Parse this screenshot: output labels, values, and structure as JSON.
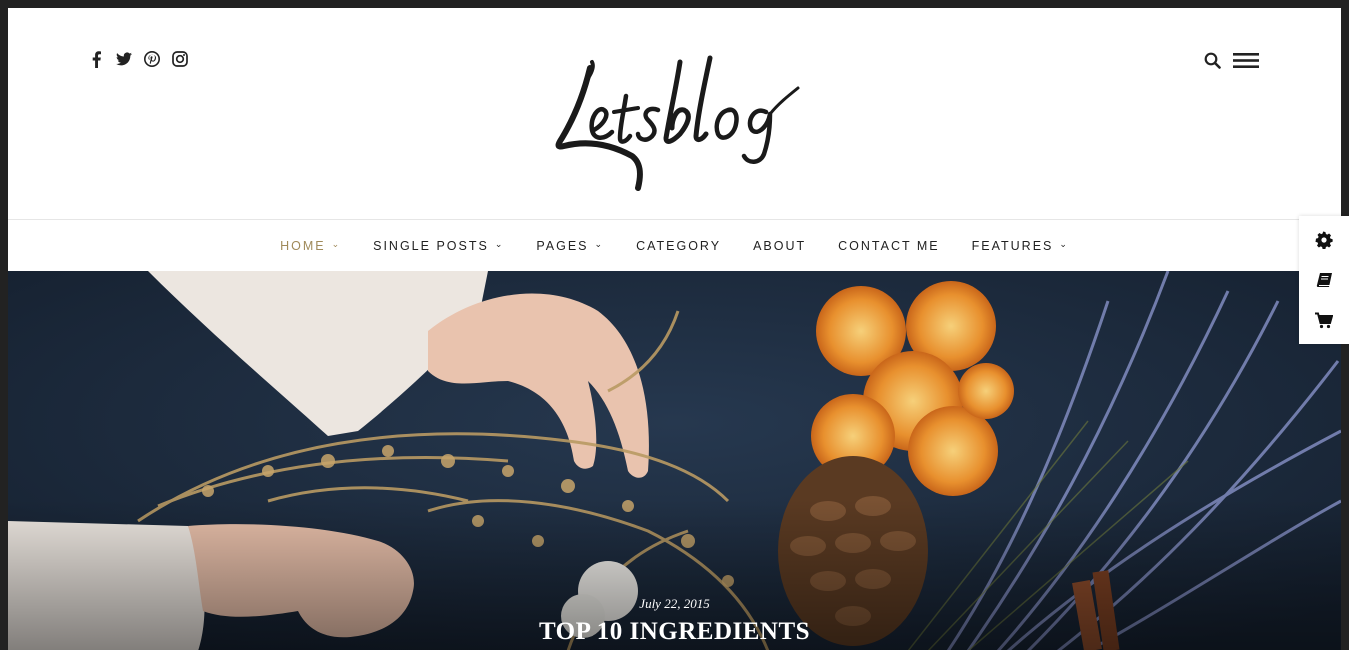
{
  "brand": {
    "logo_text": "Letsblog"
  },
  "social": [
    "facebook-icon",
    "twitter-icon",
    "pinterest-icon",
    "instagram-icon"
  ],
  "header_tools": [
    "search-icon",
    "menu-icon"
  ],
  "nav": {
    "items": [
      {
        "label": "HOME",
        "dropdown": true,
        "active": true
      },
      {
        "label": "SINGLE POSTS",
        "dropdown": true,
        "active": false
      },
      {
        "label": "PAGES",
        "dropdown": true,
        "active": false
      },
      {
        "label": "CATEGORY",
        "dropdown": false,
        "active": false
      },
      {
        "label": "ABOUT",
        "dropdown": false,
        "active": false
      },
      {
        "label": "CONTACT ME",
        "dropdown": false,
        "active": false
      },
      {
        "label": "FEATURES",
        "dropdown": true,
        "active": false
      }
    ],
    "active_color": "#a08a5a"
  },
  "hero": {
    "date": "July 22, 2015",
    "title": "TOP 10 INGREDIENTS"
  },
  "side_panel": [
    "gear-icon",
    "book-icon",
    "cart-icon"
  ]
}
